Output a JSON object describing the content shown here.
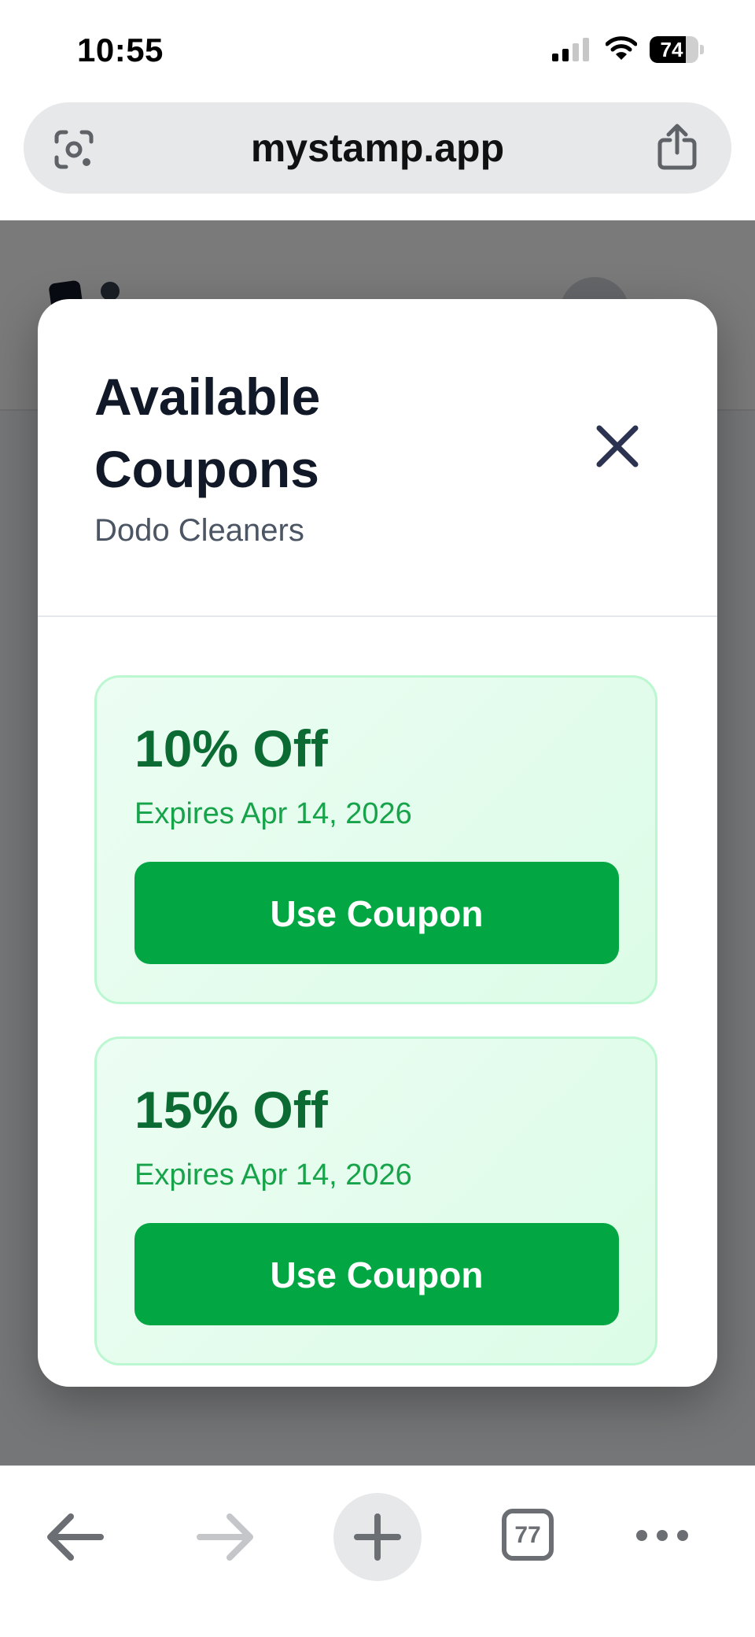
{
  "status_bar": {
    "time": "10:55",
    "battery": "74",
    "battery_level": 0.74
  },
  "browser": {
    "url": "mystamp.app",
    "tab_count": "77"
  },
  "modal": {
    "title": "Available Coupons",
    "subtitle": "Dodo Cleaners",
    "coupons": [
      {
        "title": "10% Off",
        "expires": "Expires Apr 14, 2026",
        "button": "Use Coupon"
      },
      {
        "title": "15% Off",
        "expires": "Expires Apr 14, 2026",
        "button": "Use Coupon"
      }
    ]
  },
  "colors": {
    "accent_green": "#02a642",
    "coupon_title": "#0b6b33",
    "coupon_bg": "#dcfce7"
  },
  "icons": [
    "google-lens-icon",
    "share-icon",
    "close-icon",
    "back-arrow-icon",
    "forward-arrow-icon",
    "plus-icon",
    "tabs-icon",
    "more-icon"
  ]
}
